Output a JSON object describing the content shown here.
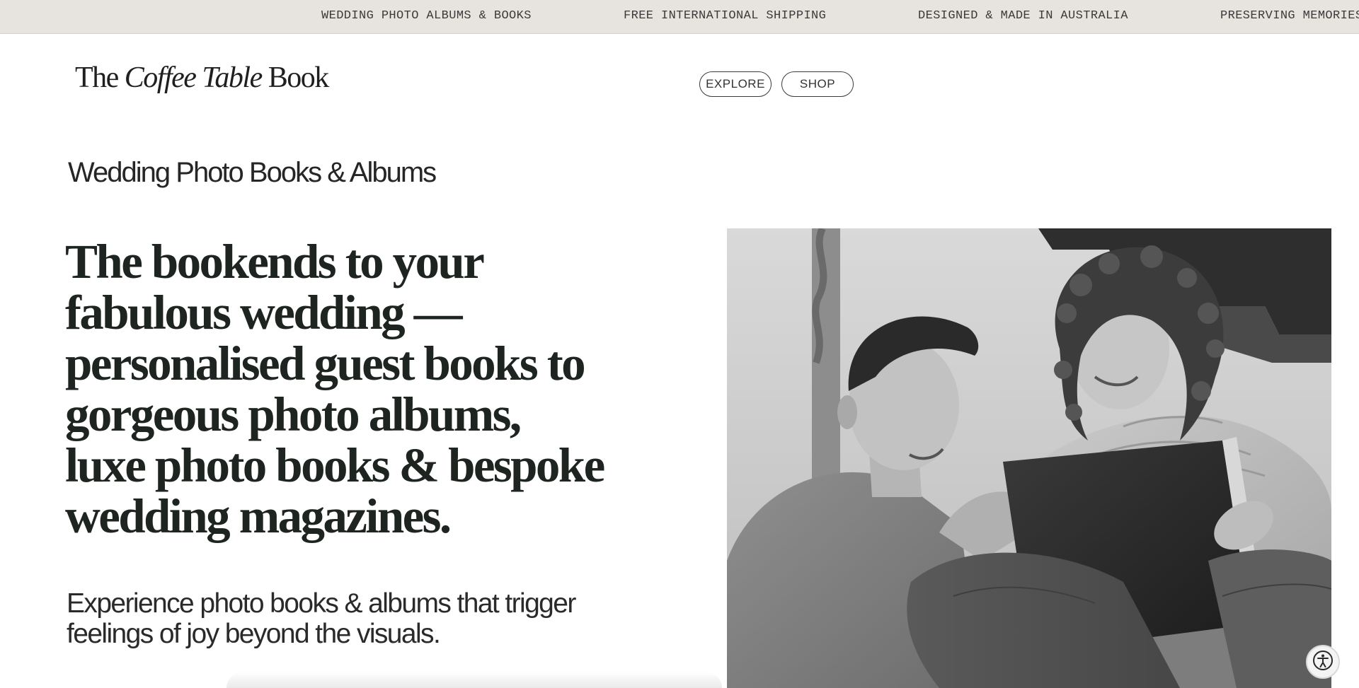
{
  "ticker": {
    "items": [
      "WEDDING PHOTO ALBUMS & BOOKS",
      "FREE INTERNATIONAL SHIPPING",
      "DESIGNED & MADE IN AUSTRALIA",
      "PRESERVING MEMORIES"
    ]
  },
  "header": {
    "logo": {
      "part1": "The ",
      "part2": "Coffee Table",
      "part3": " Book"
    },
    "nav": {
      "explore": "EXPLORE",
      "shop": "SHOP"
    }
  },
  "main": {
    "section_label": "Wedding Photo Books & Albums",
    "headline_lines": [
      "The bookends to your",
      "fabulous wedding —",
      "personalised guest books to",
      "gorgeous photo albums,",
      "luxe photo books & bespoke",
      "wedding magazines."
    ],
    "subtext_lines": [
      "Experience photo books & albums that trigger",
      "feelings of joy beyond the visuals."
    ]
  },
  "icons": {
    "accessibility": "accessibility-icon",
    "photo": "couple-photo-album-image"
  }
}
